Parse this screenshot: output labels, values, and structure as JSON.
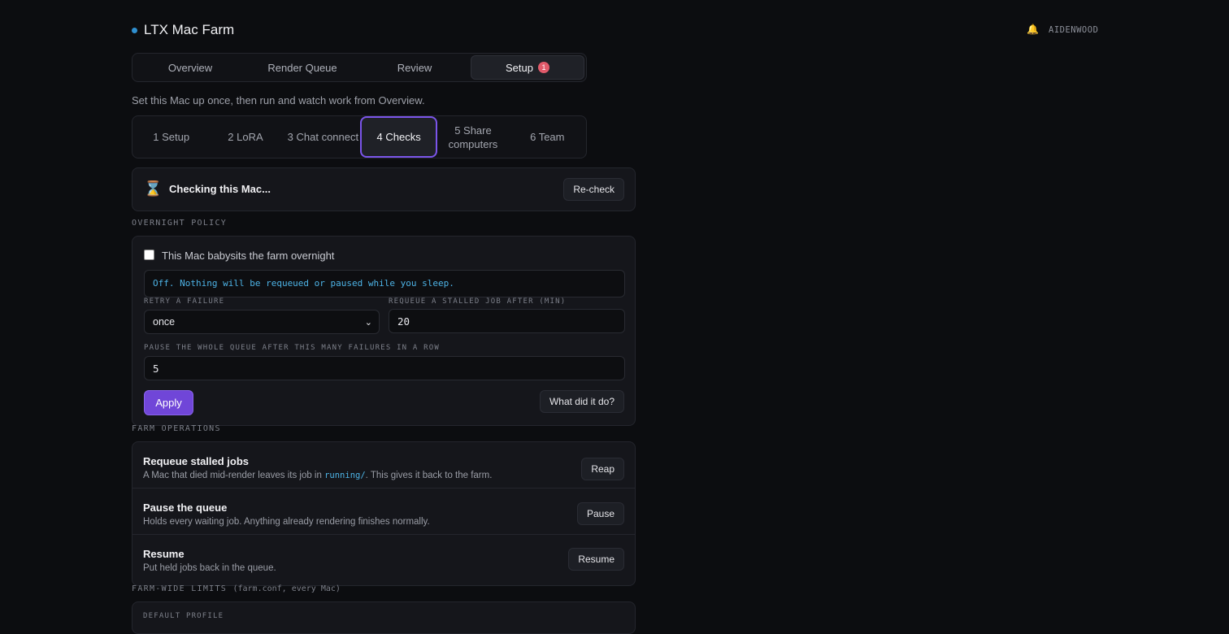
{
  "header": {
    "app_title": "LTX Mac Farm",
    "user": "AIDENWOOD",
    "bell_icon": "bell-icon",
    "status_dot_color": "#2f8fd0"
  },
  "tabs": [
    {
      "label": "Overview"
    },
    {
      "label": "Render Queue"
    },
    {
      "label": "Review"
    },
    {
      "label": "Setup",
      "badge": "1",
      "active": true
    }
  ],
  "subtitle": "Set this Mac up once, then run and watch work from Overview.",
  "steps": [
    {
      "label": "1 Setup"
    },
    {
      "label": "2 LoRA"
    },
    {
      "label": "3 Chat connect"
    },
    {
      "label": "4 Checks",
      "active": true
    },
    {
      "label": "5 Share computers"
    },
    {
      "label": "6 Team"
    }
  ],
  "check": {
    "icon": "hourglass-icon",
    "title": "Checking this Mac...",
    "recheck_label": "Re-check"
  },
  "overnight": {
    "section_label": "OVERNIGHT POLICY",
    "checkbox_label": "This Mac babysits the farm overnight",
    "checked": false,
    "note": "Off. Nothing will be requeued or paused while you sleep.",
    "retry_label": "RETRY A FAILURE",
    "retry_value": "once",
    "requeue_label": "REQUEUE A STALLED JOB AFTER (MIN)",
    "requeue_value": "20",
    "pause_label": "PAUSE THE WHOLE QUEUE AFTER THIS MANY FAILURES IN A ROW",
    "pause_value": "5",
    "apply_label": "Apply",
    "what_label": "What did it do?"
  },
  "operations": {
    "section_label": "FARM OPERATIONS",
    "items": [
      {
        "title": "Requeue stalled jobs",
        "desc_pre": "A Mac that died mid-render leaves its job in ",
        "desc_code": "running/",
        "desc_post": ". This gives it back to the farm.",
        "button": "Reap"
      },
      {
        "title": "Pause the queue",
        "desc_pre": "Holds every waiting job. Anything already rendering finishes normally.",
        "desc_code": "",
        "desc_post": "",
        "button": "Pause"
      },
      {
        "title": "Resume",
        "desc_pre": "Put held jobs back in the queue.",
        "desc_code": "",
        "desc_post": "",
        "button": "Resume"
      }
    ]
  },
  "limits": {
    "section_label": "FARM-WIDE LIMITS",
    "section_hint": "(farm.conf, every Mac)",
    "first_label": "DEFAULT PROFILE"
  },
  "colors": {
    "accent": "#7046d8",
    "active_step_ring": "#7b55ea",
    "badge": "#e05a6a",
    "info_text": "#4db3e6"
  }
}
